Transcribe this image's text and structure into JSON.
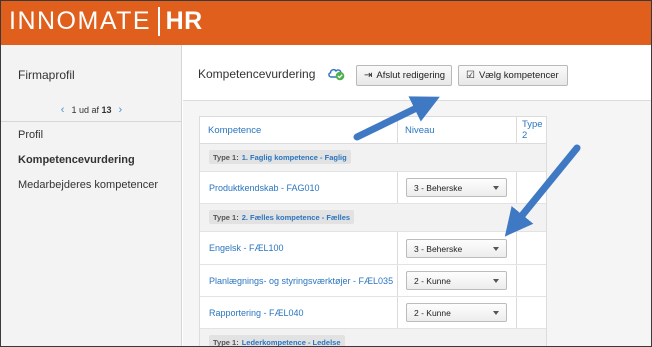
{
  "app": {
    "logo_name": "INNOMATE",
    "logo_suffix": "HR"
  },
  "sidebar": {
    "title": "Firmaprofil",
    "pager": {
      "prefix": "1 ud af",
      "total": "13"
    },
    "items": [
      {
        "label": "Profil",
        "active": false
      },
      {
        "label": "Kompetencevurdering",
        "active": true
      },
      {
        "label": "Medarbejderes kompetencer",
        "active": false
      }
    ]
  },
  "toolbar": {
    "title": "Kompetencevurdering",
    "exit_label": "Afslut redigering",
    "select_label": "Vælg kompetencer"
  },
  "table": {
    "headers": {
      "competence": "Kompetence",
      "level": "Niveau",
      "type2": "Type 2"
    },
    "rows": [
      {
        "kind": "type",
        "prefix": "Type 1:",
        "name": "1. Faglig kompetence - Faglig"
      },
      {
        "kind": "comp",
        "name": "Produktkendskab - FAG010",
        "level": "3 - Beherske"
      },
      {
        "kind": "type",
        "prefix": "Type 1:",
        "name": "2. Fælles kompetence - Fælles"
      },
      {
        "kind": "comp",
        "name": "Engelsk - FÆL100",
        "level": "3 - Beherske"
      },
      {
        "kind": "comp",
        "name": "Planlægnings- og styringsværktøjer - FÆL035",
        "level": "2 - Kunne"
      },
      {
        "kind": "comp",
        "name": "Rapportering - FÆL040",
        "level": "2 - Kunne"
      },
      {
        "kind": "type",
        "prefix": "Type 1:",
        "name": "Lederkompetence - Ledelse"
      }
    ]
  },
  "colors": {
    "header": "#e05f1d",
    "link": "#2a75c0",
    "arrow": "#3f79c4",
    "cloud": "#2a75c0",
    "check": "#4caf50"
  }
}
